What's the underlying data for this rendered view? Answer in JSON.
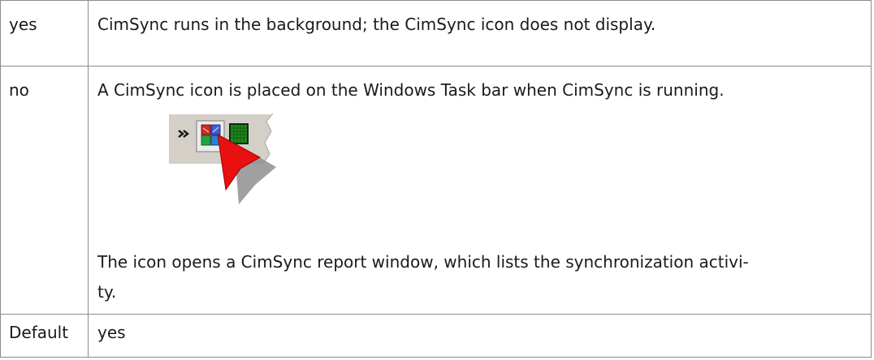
{
  "table": {
    "rows": [
      {
        "key": "yes",
        "value": "CimSync runs in the background; the CimSync icon does not display."
      },
      {
        "key": "no",
        "value": "A CimSync icon  is placed on the Windows Task bar when CimSync is running.",
        "icon": "cimsync-taskbar-icon",
        "value2": "The icon opens a CimSync report window, which lists the synchronization activi-",
        "value3": "ty."
      },
      {
        "key": "Default",
        "value": "yes"
      }
    ]
  },
  "colors": {
    "border": "#8c8c8c",
    "text": "#1a1a1a",
    "tray_bg": "#d4d0c8",
    "pointer_red": "#e81010",
    "icon_green": "#1e8a1e"
  }
}
